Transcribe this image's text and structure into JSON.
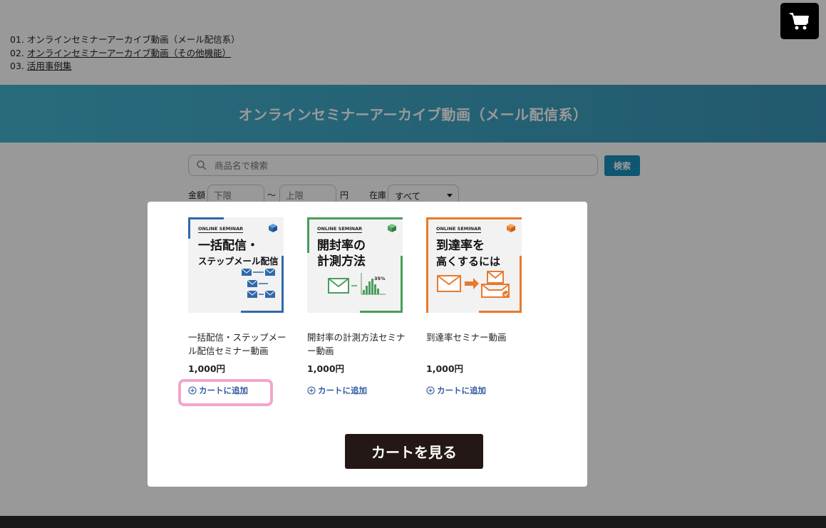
{
  "toc": {
    "items": [
      {
        "num": "01.",
        "label": "オンラインセミナーアーカイブ動画（メール配信系）"
      },
      {
        "num": "02.",
        "label": "オンラインセミナーアーカイブ動画（その他機能）"
      },
      {
        "num": "03.",
        "label": "活用事例集"
      }
    ]
  },
  "banner": {
    "title": "オンラインセミナーアーカイブ動画（メール配信系）"
  },
  "search": {
    "placeholder": "商品名で検索",
    "button": "検索"
  },
  "filters": {
    "price_label": "金額",
    "min_placeholder": "下限",
    "tilde": "～",
    "max_placeholder": "上限",
    "yen": "円",
    "stock_label": "在庫",
    "stock_value": "すべて"
  },
  "products": [
    {
      "name": "一括配信・ステップメール配信セミナー動画",
      "price": "1,000円",
      "add": "カートに追加",
      "thumb": {
        "tag": "ONLINE SEMINAR",
        "line1": "一括配信・",
        "line2": "ステップメール配信",
        "accent": "#2f69aa"
      }
    },
    {
      "name": "開封率の計測方法セミナー動画",
      "price": "1,000円",
      "add": "カートに追加",
      "thumb": {
        "tag": "ONLINE SEMINAR",
        "line1": "開封率の",
        "line2": "計測方法",
        "stat": "35%",
        "accent": "#4a9d5b"
      }
    },
    {
      "name": "到達率セミナー動画",
      "price": "1,000円",
      "add": "カートに追加",
      "thumb": {
        "tag": "ONLINE SEMINAR",
        "line1": "到達率を",
        "line2": "高くするには",
        "accent": "#e87a2d"
      }
    }
  ],
  "modal": {
    "view_cart": "カートを見る"
  }
}
